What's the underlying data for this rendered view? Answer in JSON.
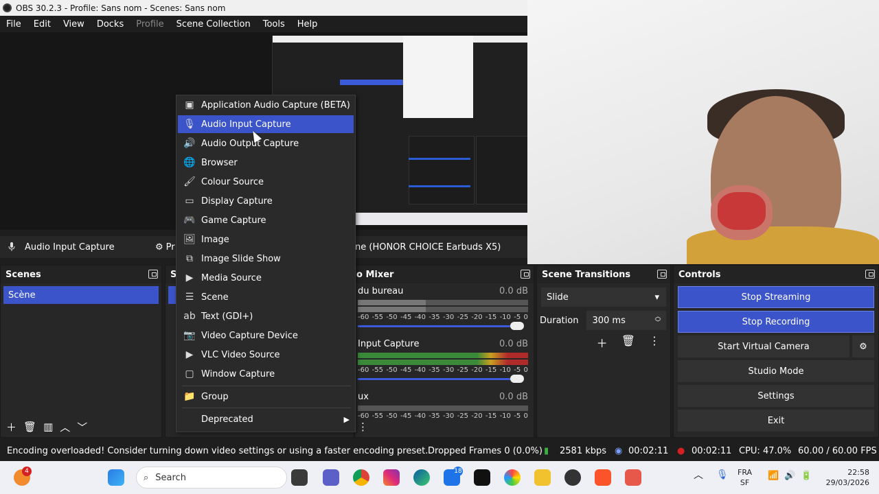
{
  "window": {
    "title": "OBS 30.2.3 - Profile: Sans nom - Scenes: Sans nom"
  },
  "menubar": [
    "File",
    "Edit",
    "View",
    "Docks",
    "Profile",
    "Scene Collection",
    "Tools",
    "Help"
  ],
  "source_toolbar": {
    "source_name": "Audio Input Capture",
    "properties_partial": "Pr",
    "device_partial": "ne (HONOR CHOICE Earbuds X5)"
  },
  "scenes": {
    "title": "Scenes",
    "items": [
      "Scène"
    ]
  },
  "sources_partial_title": "S",
  "mixer": {
    "title_partial": "o Mixer",
    "channels": [
      {
        "name": "du bureau",
        "db": "0.0 dB"
      },
      {
        "name": "Input Capture",
        "db": "0.0 dB"
      },
      {
        "name": "ux",
        "db": "0.0 dB"
      }
    ],
    "ticks": [
      "-60",
      "-55",
      "-50",
      "-45",
      "-40",
      "-35",
      "-30",
      "-25",
      "-20",
      "-15",
      "-10",
      "-5",
      "0"
    ]
  },
  "transitions": {
    "title": "Scene Transitions",
    "selected": "Slide",
    "duration_label": "Duration",
    "duration_value": "300 ms"
  },
  "controls": {
    "title": "Controls",
    "buttons": [
      "Stop Streaming",
      "Stop Recording",
      "Start Virtual Camera",
      "Studio Mode",
      "Settings",
      "Exit"
    ]
  },
  "context_menu": {
    "items": [
      {
        "label": "Application Audio Capture (BETA)",
        "icon": "app-audio-icon"
      },
      {
        "label": "Audio Input Capture",
        "icon": "microphone-icon",
        "highlighted": true
      },
      {
        "label": "Audio Output Capture",
        "icon": "speaker-icon"
      },
      {
        "label": "Browser",
        "icon": "globe-icon"
      },
      {
        "label": "Colour Source",
        "icon": "brush-icon"
      },
      {
        "label": "Display Capture",
        "icon": "monitor-icon"
      },
      {
        "label": "Game Capture",
        "icon": "gamepad-icon"
      },
      {
        "label": "Image",
        "icon": "image-icon"
      },
      {
        "label": "Image Slide Show",
        "icon": "slideshow-icon"
      },
      {
        "label": "Media Source",
        "icon": "play-icon"
      },
      {
        "label": "Scene",
        "icon": "list-icon"
      },
      {
        "label": "Text (GDI+)",
        "icon": "text-icon"
      },
      {
        "label": "Video Capture Device",
        "icon": "camera-icon"
      },
      {
        "label": "VLC Video Source",
        "icon": "play-icon"
      },
      {
        "label": "Window Capture",
        "icon": "window-icon"
      }
    ],
    "group": "Group",
    "deprecated": "Deprecated"
  },
  "statusbar": {
    "message": "Encoding overloaded! Consider turning down video settings or using a faster encoding preset.",
    "dropped_frames": "Dropped Frames 0 (0.0%)",
    "bitrate": "2581 kbps",
    "stream_time": "00:02:11",
    "rec_time": "00:02:11",
    "cpu": "CPU: 47.0%",
    "fps": "60.00 / 60.00 FPS"
  },
  "taskbar": {
    "search_placeholder": "Search",
    "lang_top": "FRA",
    "lang_bottom": "SF",
    "time": "22:58",
    "date": "29/03/2026",
    "badge_left": "4",
    "badge_app": "18"
  },
  "colors": {
    "accent": "#3c54c9",
    "panel": "#272727",
    "background": "#1e1e1e",
    "rec_red": "#d42020",
    "bitrate_green": "#3cb043"
  }
}
